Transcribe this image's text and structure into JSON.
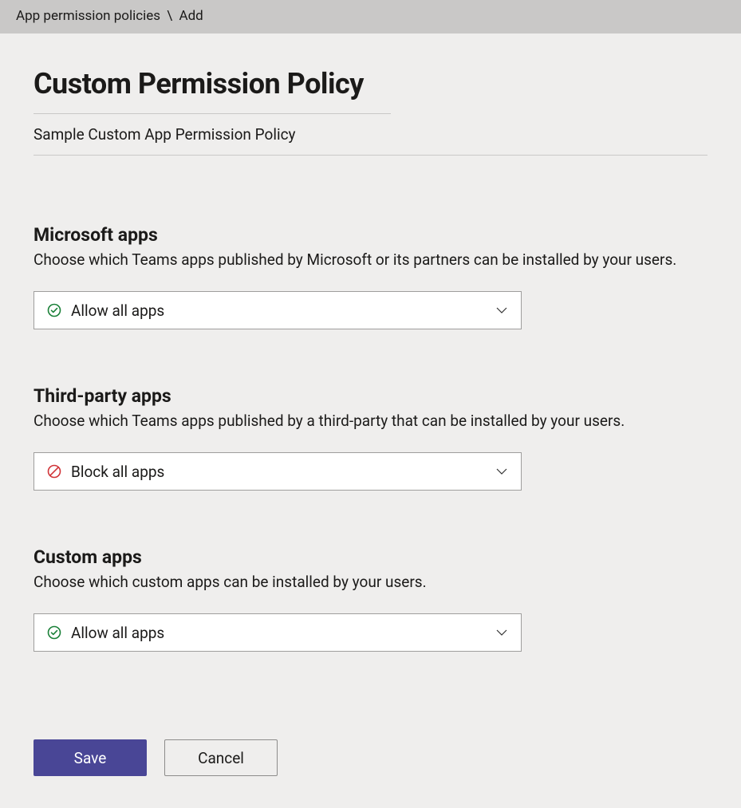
{
  "breadcrumb": {
    "parent": "App permission policies",
    "separator": "\\",
    "current": "Add"
  },
  "header": {
    "title": "Custom Permission Policy",
    "policy_name": "Sample Custom App Permission Policy"
  },
  "sections": [
    {
      "title": "Microsoft apps",
      "description": "Choose which Teams apps published by Microsoft or its partners can be installed by your users.",
      "selected": "Allow all apps",
      "status": "allow"
    },
    {
      "title": "Third-party apps",
      "description": "Choose which Teams apps published by a third-party that can be installed by your users.",
      "selected": "Block all apps",
      "status": "block"
    },
    {
      "title": "Custom apps",
      "description": "Choose which custom apps can be installed by your users.",
      "selected": "Allow all apps",
      "status": "allow"
    }
  ],
  "buttons": {
    "save": "Save",
    "cancel": "Cancel"
  }
}
